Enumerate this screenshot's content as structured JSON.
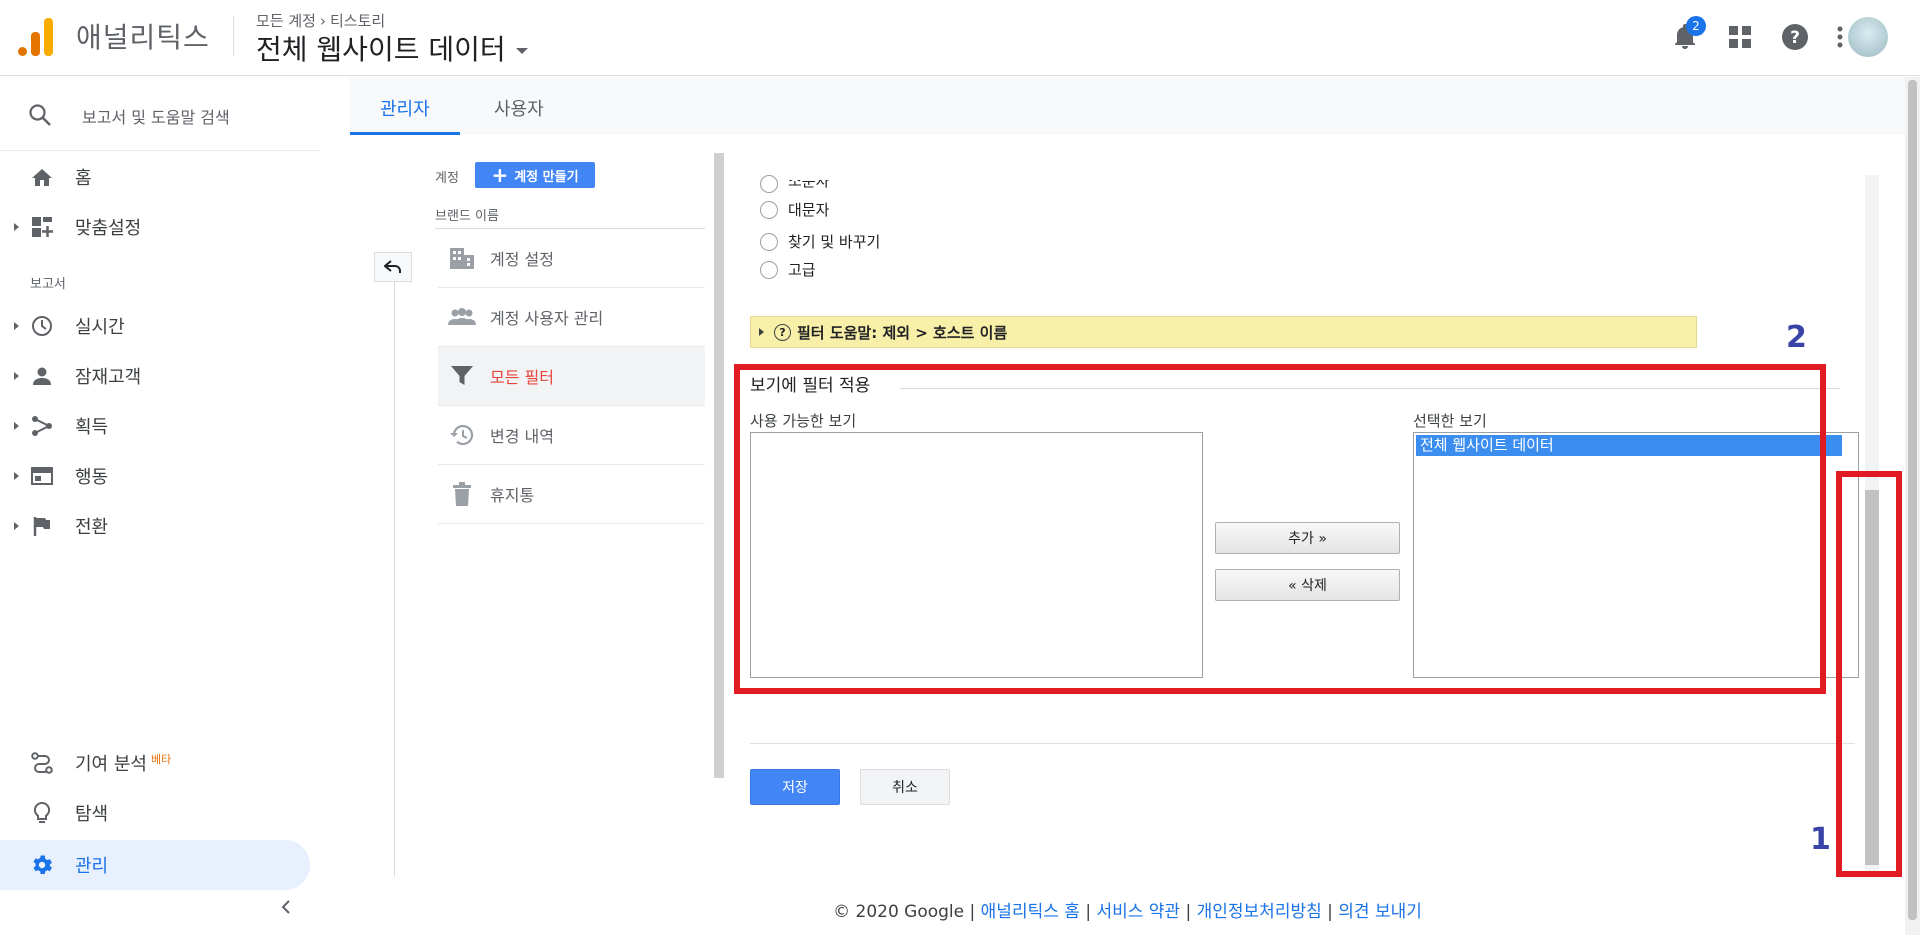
{
  "header": {
    "app_name": "애널리틱스",
    "breadcrumb_account": "모든 계정",
    "breadcrumb_property": "티스토리",
    "view_title": "전체 웹사이트 데이터",
    "notification_count": "2"
  },
  "sidebar": {
    "search_label": "보고서 및 도움말 검색",
    "home": "홈",
    "customization": "맞춤설정",
    "reports_section": "보고서",
    "realtime": "실시간",
    "audience": "잠재고객",
    "acquisition": "획득",
    "behavior": "행동",
    "conversions": "전환",
    "attribution": "기여 분석",
    "beta": "베타",
    "discover": "탐색",
    "admin": "관리"
  },
  "tabs": {
    "admin": "관리자",
    "user": "사용자"
  },
  "account_column": {
    "account_label": "계정",
    "create_account": "계정 만들기",
    "brand_label": "브랜드 이름",
    "items": [
      "계정 설정",
      "계정 사용자 관리",
      "모든 필터",
      "변경 내역",
      "휴지통"
    ]
  },
  "filter_form": {
    "radio_partial": "소문자",
    "radio_upper": "대문자",
    "radio_replace": "찾기 및 바꾸기",
    "radio_advanced": "고급",
    "help_text": "필터 도움말: 제외 > 호스트 이름",
    "apply_legend": "보기에 필터 적용",
    "available_label": "사용 가능한 보기",
    "selected_label": "선택한 보기",
    "selected_view": "전체 웹사이트 데이터",
    "add_button": "추가 »",
    "remove_button": "« 삭제",
    "save_button": "저장",
    "cancel_button": "취소"
  },
  "annotations": {
    "label_1": "1",
    "label_2": "2"
  },
  "footer": {
    "copyright": "© 2020 Google",
    "sep": "|",
    "link_home": "애널리틱스 홈",
    "link_terms": "서비스 약관",
    "link_privacy": "개인정보처리방침",
    "link_feedback": "의견 보내기"
  },
  "colors": {
    "accent": "#1a73e8",
    "annotation_red": "#e01b24",
    "annotation_number": "#3a44a8",
    "help_bar": "#f8f0a8"
  }
}
